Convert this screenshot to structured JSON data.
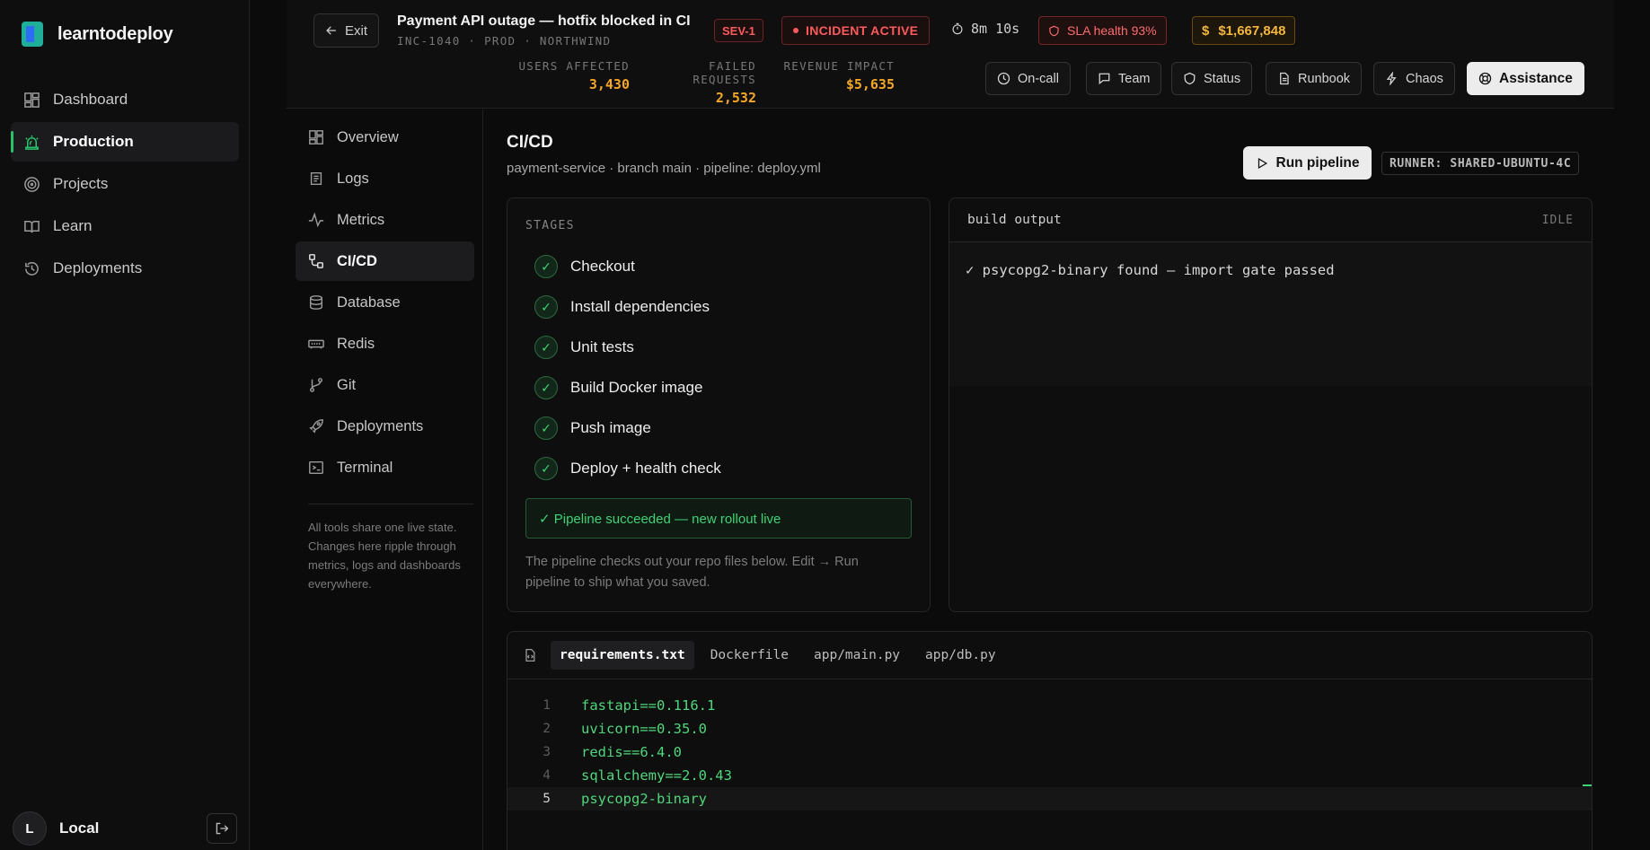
{
  "app": {
    "name": "learntodeploy"
  },
  "app_nav": [
    {
      "label": "Dashboard",
      "icon": "dashboard-icon"
    },
    {
      "label": "Production",
      "icon": "siren-icon",
      "active": true
    },
    {
      "label": "Projects",
      "icon": "target-icon"
    },
    {
      "label": "Learn",
      "icon": "book-icon"
    },
    {
      "label": "Deployments",
      "icon": "history-icon"
    }
  ],
  "user": {
    "initial": "L",
    "name": "Local"
  },
  "header": {
    "exit_label": "Exit",
    "title": "Payment API outage — hotfix blocked in CI",
    "subtitle": "INC-1040 · PROD · NORTHWIND",
    "severity": "SEV-1",
    "incident_status": "INCIDENT ACTIVE",
    "timer": "8m 10s",
    "sla": "SLA health 93%",
    "cost": "$1,667,848",
    "stats": [
      {
        "label": "USERS AFFECTED",
        "value": "3,430"
      },
      {
        "label": "FAILED REQUESTS",
        "value": "2,532"
      },
      {
        "label": "REVENUE IMPACT",
        "value": "$5,635"
      }
    ],
    "buttons": {
      "oncall": "On-call",
      "team": "Team",
      "status": "Status",
      "runbook": "Runbook",
      "chaos": "Chaos",
      "assistance": "Assistance"
    }
  },
  "tools_nav": [
    {
      "label": "Overview",
      "icon": "grid-icon"
    },
    {
      "label": "Logs",
      "icon": "logs-icon"
    },
    {
      "label": "Metrics",
      "icon": "activity-icon"
    },
    {
      "label": "CI/CD",
      "icon": "pipeline-icon",
      "active": true
    },
    {
      "label": "Database",
      "icon": "database-icon"
    },
    {
      "label": "Redis",
      "icon": "memory-icon"
    },
    {
      "label": "Git",
      "icon": "git-branch-icon"
    },
    {
      "label": "Deployments",
      "icon": "rocket-icon"
    },
    {
      "label": "Terminal",
      "icon": "terminal-icon"
    }
  ],
  "tools_note": "All tools share one live state. Changes here ripple through metrics, logs and dashboards everywhere.",
  "main": {
    "title": "CI/CD",
    "subtitle": "payment-service · branch main · pipeline: deploy.yml",
    "run_label": "Run pipeline",
    "runner": "RUNNER: SHARED-UBUNTU-4C"
  },
  "stages": {
    "label": "STAGES",
    "items": [
      {
        "label": "Checkout",
        "status": "passed"
      },
      {
        "label": "Install dependencies",
        "status": "passed"
      },
      {
        "label": "Unit tests",
        "status": "passed"
      },
      {
        "label": "Build Docker image",
        "status": "passed"
      },
      {
        "label": "Push image",
        "status": "passed"
      },
      {
        "label": "Deploy + health check",
        "status": "passed"
      }
    ],
    "result": "✓ Pipeline succeeded — new rollout live",
    "note": "The pipeline checks out your repo files below. Edit → Run pipeline to ship what you saved."
  },
  "output": {
    "title": "build output",
    "state": "IDLE",
    "lines": [
      "✓ psycopg2-binary found — import gate passed"
    ]
  },
  "editor": {
    "tabs": [
      {
        "label": "requirements.txt",
        "active": true
      },
      {
        "label": "Dockerfile"
      },
      {
        "label": "app/main.py"
      },
      {
        "label": "app/db.py"
      }
    ],
    "lines": [
      {
        "n": "1",
        "text": "fastapi==0.116.1"
      },
      {
        "n": "2",
        "text": "uvicorn==0.35.0"
      },
      {
        "n": "3",
        "text": "redis==6.4.0"
      },
      {
        "n": "4",
        "text": "sqlalchemy==2.0.43"
      },
      {
        "n": "5",
        "text": "psycopg2-binary",
        "current": true
      }
    ]
  },
  "colors": {
    "accent_green": "#3dd374",
    "alert_red": "#ff5a5a",
    "money_amber": "#f5b73b"
  }
}
